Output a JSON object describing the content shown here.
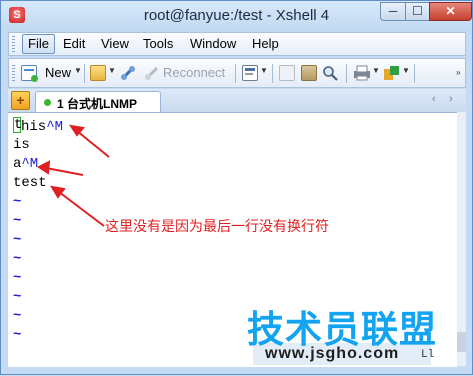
{
  "window": {
    "title": "root@fanyue:/test - Xshell 4",
    "minimize_glyph": "─",
    "maximize_glyph": "☐",
    "close_glyph": "✕"
  },
  "menu": {
    "items": [
      {
        "label": "File"
      },
      {
        "label": "Edit"
      },
      {
        "label": "View"
      },
      {
        "label": "Tools"
      },
      {
        "label": "Window"
      },
      {
        "label": "Help"
      }
    ]
  },
  "toolbar": {
    "new_label": "New",
    "reconnect_label": "Reconnect"
  },
  "tabs": {
    "add_glyph": "+",
    "items": [
      {
        "label": "1 台式机LNMP"
      }
    ],
    "prev_glyph": "‹",
    "next_glyph": "›"
  },
  "terminal": {
    "lines": [
      {
        "cursor_char": "t",
        "text": "his",
        "ctrl": "^M"
      },
      {
        "text": "is"
      },
      {
        "text": "a",
        "ctrl": "^M"
      },
      {
        "text": "test"
      }
    ],
    "tilde": "~",
    "status_fragment": "Ll"
  },
  "annotation": {
    "text": "这里没有是因为最后一行没有换行符",
    "color": "#e02020"
  },
  "watermark": {
    "title": "技术员联盟",
    "url": "www.jsgho.com"
  },
  "icons": [
    "app-icon",
    "new-session-icon",
    "open-folder-icon",
    "connect-icon",
    "reconnect-icon",
    "properties-icon",
    "copy-icon",
    "paste-icon",
    "find-icon",
    "print-icon",
    "transfer-icon",
    "add-tab-icon",
    "session-status-icon"
  ]
}
